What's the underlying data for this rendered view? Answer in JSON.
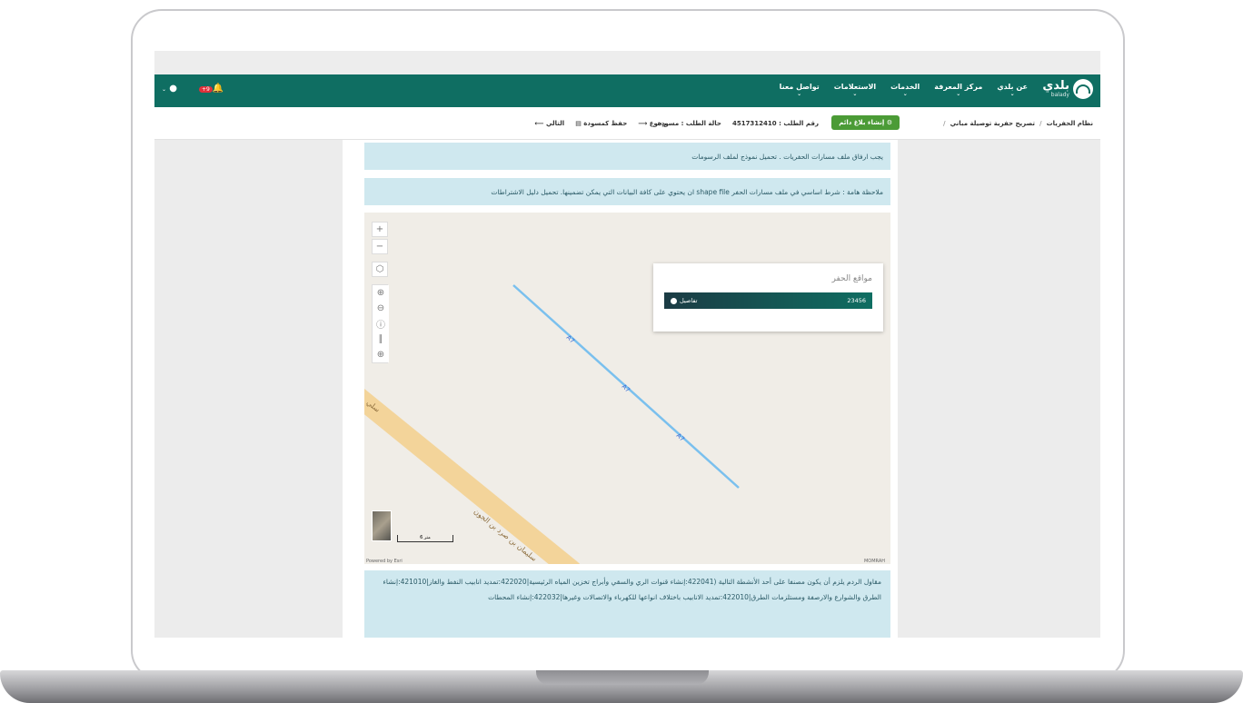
{
  "nav": {
    "logo_text": "بلدي",
    "logo_sub": "balady",
    "items": [
      {
        "label": "عن بلدي"
      },
      {
        "label": "مركز المعرفة"
      },
      {
        "label": "الخدمات"
      },
      {
        "label": "الاستعلامات"
      },
      {
        "label": "تواصل معنا"
      }
    ],
    "notification_count": "+9"
  },
  "breadcrumb": {
    "root": "نظام الحفريات",
    "current": "تصريح حفرية توصيلة مباني"
  },
  "toolbar": {
    "create_report": "إنشاء بلاغ دائم",
    "request_number": "رقم الطلب : 4517312410",
    "request_status": "حالة الطلب : مسودة",
    "back": "رجوع",
    "save_draft": "حفظ كمسودة",
    "next": "التالي"
  },
  "alerts": {
    "attach": "يجب ارفاق ملف مسارات الحفريات . تحميل نموذج لملف الرسومات",
    "note": "ملاحظة هامة : شرط اساسي في ملف مسارات الحفر shape file ان يحتوي على كافة البيانات التي يمكن تضمينها. تحميل دليل الاشتراطات"
  },
  "map": {
    "popup_title": "مواقع الحفر",
    "popup_id": "23456",
    "popup_details": "تفاصيل",
    "street_label": "سليمان بن صرد بن الجون",
    "street_label_short": "سلي",
    "scale": "6 متر",
    "powered_by": "Powered by Esri",
    "attribution": "MOMRAH",
    "colors": {
      "route": "#7ac0ee",
      "road": "#f3d49a"
    }
  },
  "contractor_note": "مقاول الردم يلزم أن يكون مصنفا على أحد الأنشطة التالية (422041:إنشاء قنوات الري والسقي وأبراج تخزين المياه الرئيسية|422020:تمديد انابيب النفط والغاز|421010:إنشاء الطرق والشوارع والارصفة ومستلزمات الطرق|422010:تمديد الانابيب باختلاف انواعها للكهرباء والاتصالات وغيرها|422032:إنشاء المحطات"
}
